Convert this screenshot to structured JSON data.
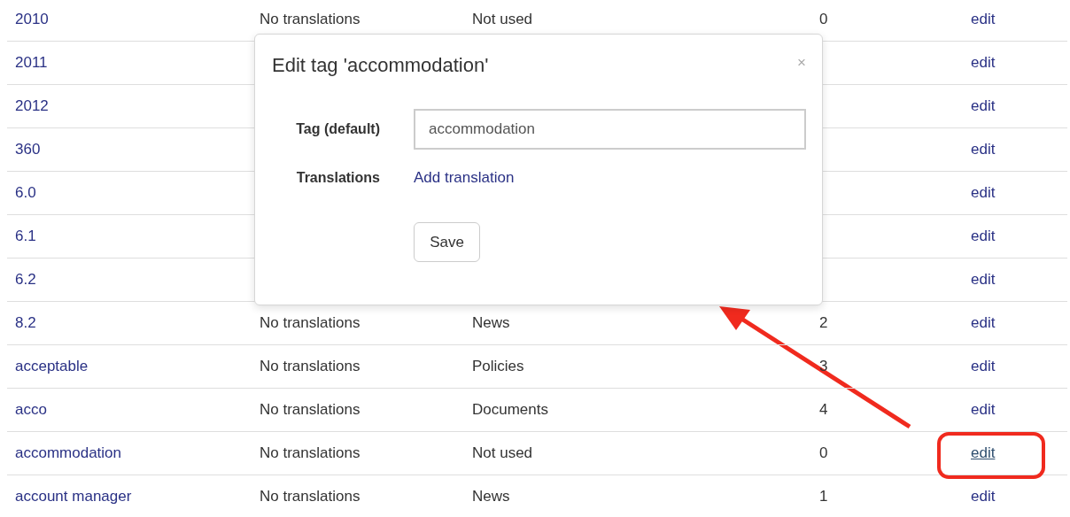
{
  "table": {
    "rows": [
      {
        "tag": "2010",
        "translations": "No translations",
        "usage": "Not used",
        "count": "0",
        "action": "edit",
        "hovered": false,
        "highlighted": false
      },
      {
        "tag": "2011",
        "action": "edit",
        "hovered": false,
        "highlighted": false
      },
      {
        "tag": "2012",
        "action": "edit",
        "hovered": false,
        "highlighted": false
      },
      {
        "tag": "360",
        "action": "edit",
        "hovered": false,
        "highlighted": false
      },
      {
        "tag": "6.0",
        "action": "edit",
        "hovered": false,
        "highlighted": false
      },
      {
        "tag": "6.1",
        "action": "edit",
        "hovered": false,
        "highlighted": false
      },
      {
        "tag": "6.2",
        "action": "edit",
        "hovered": false,
        "highlighted": false
      },
      {
        "tag": "8.2",
        "translations": "No translations",
        "usage": "News",
        "count": "2",
        "action": "edit",
        "hovered": false,
        "highlighted": false
      },
      {
        "tag": "acceptable",
        "translations": "No translations",
        "usage": "Policies",
        "count": "3",
        "action": "edit",
        "hovered": false,
        "highlighted": false
      },
      {
        "tag": "acco",
        "translations": "No translations",
        "usage": "Documents",
        "count": "4",
        "action": "edit",
        "hovered": false,
        "highlighted": false
      },
      {
        "tag": "accommodation",
        "translations": "No translations",
        "usage": "Not used",
        "count": "0",
        "action": "edit",
        "hovered": true,
        "highlighted": true
      },
      {
        "tag": "account manager",
        "translations": "No translations",
        "usage": "News",
        "count": "1",
        "action": "edit",
        "hovered": false,
        "highlighted": false
      }
    ]
  },
  "modal": {
    "title": "Edit tag 'accommodation'",
    "close": "×",
    "tag_label": "Tag (default)",
    "tag_value": "accommodation",
    "translations_label": "Translations",
    "add_translation": "Add translation",
    "save": "Save"
  }
}
